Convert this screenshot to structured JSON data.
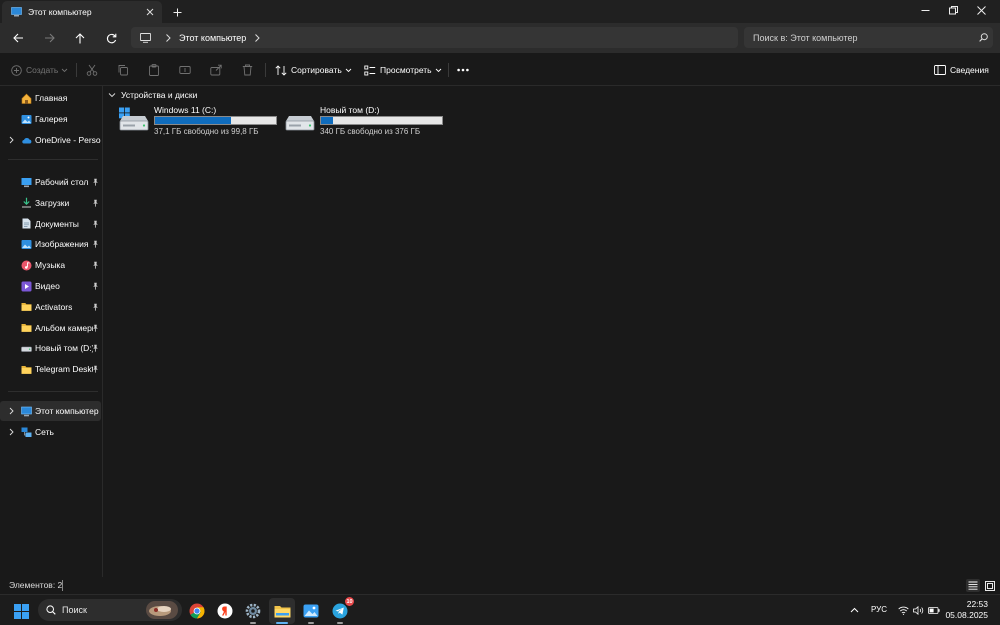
{
  "window": {
    "tab_title": "Этот компьютер",
    "new_tab_symbol": "+"
  },
  "address": {
    "crumb": "Этот компьютер",
    "search_placeholder": "Поиск в: Этот компьютер"
  },
  "commands": {
    "create": "Создать",
    "sort": "Сортировать",
    "view": "Просмотреть",
    "more": "...",
    "details": "Сведения"
  },
  "sidebar": {
    "home": "Главная",
    "gallery": "Галерея",
    "onedrive": "OneDrive - Personal",
    "pinned": [
      {
        "label": "Рабочий стол",
        "icon": "desktop-icon"
      },
      {
        "label": "Загрузки",
        "icon": "downloads-icon"
      },
      {
        "label": "Документы",
        "icon": "documents-icon"
      },
      {
        "label": "Изображения",
        "icon": "pictures-icon"
      },
      {
        "label": "Музыка",
        "icon": "music-icon"
      },
      {
        "label": "Видео",
        "icon": "videos-icon"
      },
      {
        "label": "Activators",
        "icon": "folder-icon"
      },
      {
        "label": "Альбом камеры",
        "icon": "folder-icon"
      },
      {
        "label": "Новый том (D:)",
        "icon": "drive-icon"
      },
      {
        "label": "Telegram Desktop",
        "icon": "folder-icon"
      }
    ],
    "this_pc": "Этот компьютер",
    "network": "Сеть"
  },
  "content": {
    "group_title": "Устройства и диски",
    "drives": [
      {
        "name": "Windows 11 (C:)",
        "free_text": "37,1 ГБ свободно из 99,8 ГБ",
        "used_fraction": 0.628
      },
      {
        "name": "Новый том (D:)",
        "free_text": "340 ГБ свободно из 376 ГБ",
        "used_fraction": 0.096
      }
    ]
  },
  "status": {
    "items_count": "Элементов: 2"
  },
  "taskbar": {
    "search_label": "Поиск",
    "lang": "РУС",
    "time": "22:53",
    "date": "05.08.2025",
    "telegram_badge": "10"
  },
  "colors": {
    "accent": "#0f6cbd",
    "background": "#191919",
    "chrome": "#2c2c2c"
  }
}
